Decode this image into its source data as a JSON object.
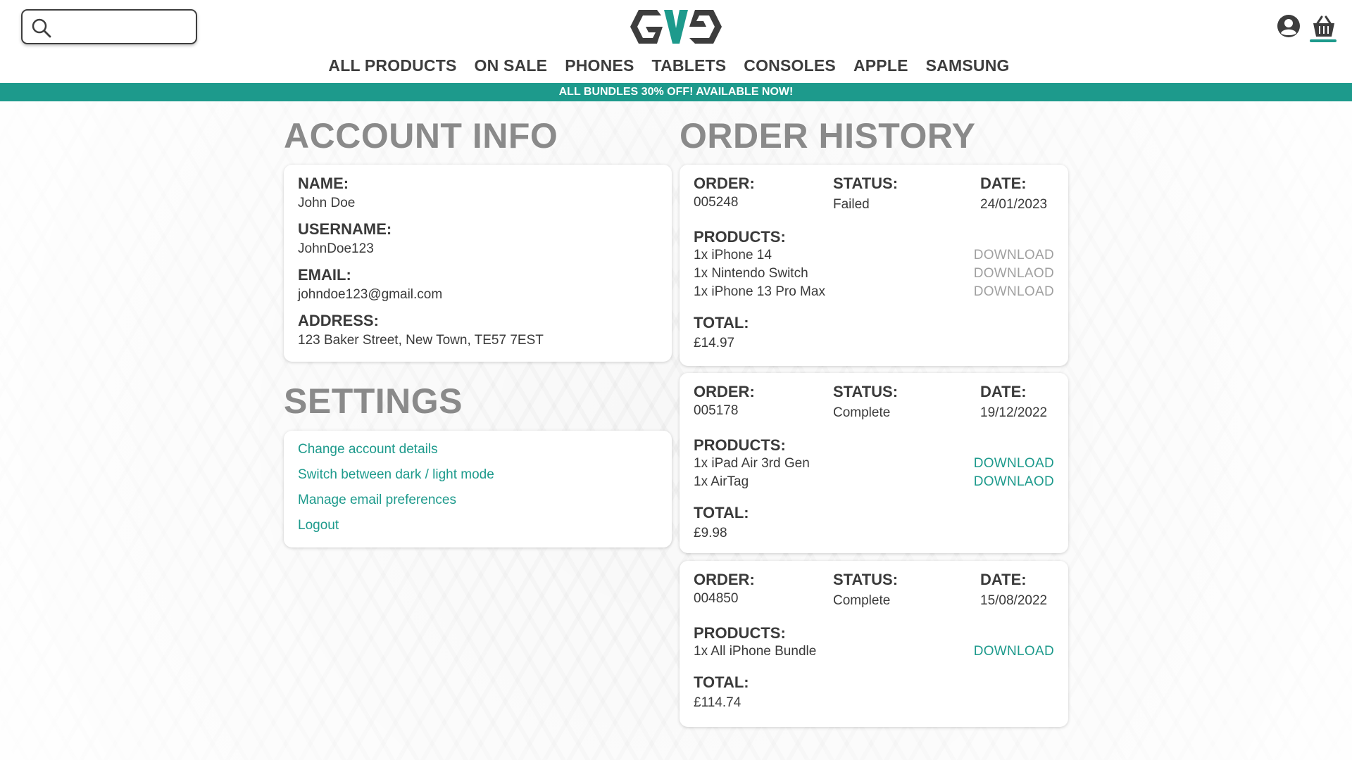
{
  "search": {
    "placeholder": "",
    "value": ""
  },
  "nav": [
    "ALL PRODUCTS",
    "ON SALE",
    "PHONES",
    "TABLETS",
    "CONSOLES",
    "APPLE",
    "SAMSUNG"
  ],
  "banner": "ALL BUNDLES 30% OFF! AVAILABLE NOW!",
  "colors": {
    "accent": "#1d9a8c",
    "text": "#3a3a3a",
    "heading": "#8a8a8a",
    "disabled": "#a0a0a0"
  },
  "account": {
    "title": "ACCOUNT INFO",
    "fields": [
      {
        "label": "NAME:",
        "value": "John Doe"
      },
      {
        "label": "USERNAME:",
        "value": "JohnDoe123"
      },
      {
        "label": "EMAIL:",
        "value": "johndoe123@gmail.com"
      },
      {
        "label": "ADDRESS:",
        "value": "123 Baker Street, New Town, TE57 7EST"
      }
    ]
  },
  "settings": {
    "title": "SETTINGS",
    "links": [
      "Change account details",
      "Switch between dark / light mode",
      "Manage email preferences",
      "Logout"
    ]
  },
  "orders": {
    "title": "ORDER HISTORY",
    "labels": {
      "order": "ORDER:",
      "status": "STATUS:",
      "date": "DATE:",
      "products": "PRODUCTS:",
      "total": "TOTAL:"
    },
    "items": [
      {
        "order": "005248",
        "status": "Failed",
        "date": "24/01/2023",
        "total": "£14.97",
        "downloads_enabled": false,
        "products": [
          {
            "name": "1x iPhone 14",
            "download": "DOWNLOAD"
          },
          {
            "name": "1x Nintendo Switch",
            "download": "DOWNLAOD"
          },
          {
            "name": "1x iPhone 13 Pro Max",
            "download": "DOWNLOAD"
          }
        ]
      },
      {
        "order": "005178",
        "status": "Complete",
        "date": "19/12/2022",
        "total": "£9.98",
        "downloads_enabled": true,
        "products": [
          {
            "name": "1x iPad Air 3rd Gen",
            "download": "DOWNLOAD"
          },
          {
            "name": "1x AirTag",
            "download": "DOWNLAOD"
          }
        ]
      },
      {
        "order": "004850",
        "status": "Complete",
        "date": "15/08/2022",
        "total": "£114.74",
        "downloads_enabled": true,
        "products": [
          {
            "name": "1x All iPhone Bundle",
            "download": "DOWNLOAD"
          }
        ]
      }
    ]
  }
}
